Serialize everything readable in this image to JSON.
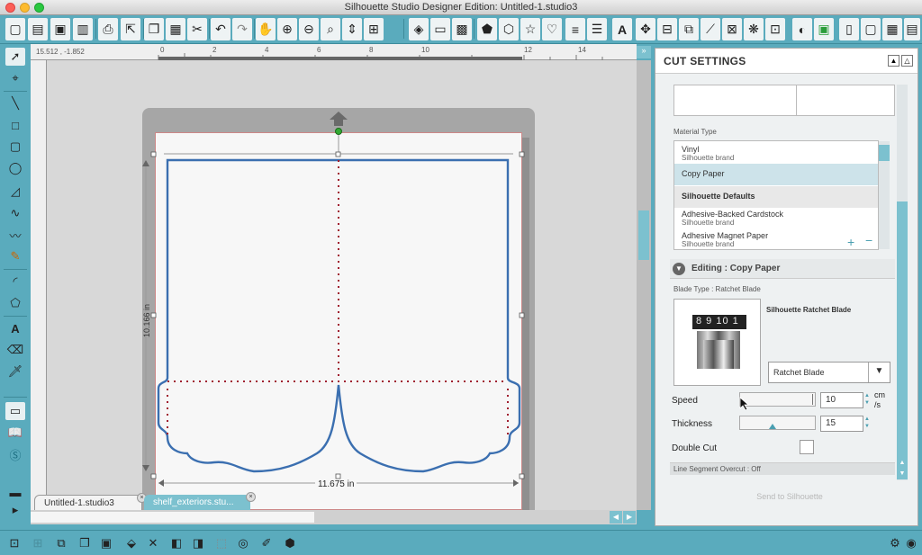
{
  "window": {
    "title": "Silhouette Studio Designer Edition: Untitled-1.studio3"
  },
  "ruler": {
    "coords": "15.512 , -1.852",
    "top_numbers": [
      "0",
      "2",
      "4",
      "6",
      "8",
      "10",
      "12",
      "14"
    ]
  },
  "canvas": {
    "width_label": "11.675 in",
    "height_label": "10.166 in"
  },
  "tabs": [
    {
      "label": "Untitled-1.studio3"
    },
    {
      "label": "shelf_exteriors.stu..."
    }
  ],
  "panel": {
    "title": "CUT SETTINGS",
    "material_type_label": "Material Type",
    "materials": [
      {
        "name": "Vinyl",
        "brand": "Silhouette brand"
      },
      {
        "name": "Copy Paper",
        "brand": ""
      },
      {
        "name": "Silhouette Defaults",
        "brand": ""
      },
      {
        "name": "Adhesive-Backed Cardstock",
        "brand": "Silhouette brand"
      },
      {
        "name": "Adhesive Magnet Paper",
        "brand": "Silhouette brand"
      }
    ],
    "editing_label": "Editing : Copy Paper",
    "blade_type_label": "Blade Type : Ratchet Blade",
    "blade_name": "Silhouette Ratchet Blade",
    "blade_numbers": "8 9 10 1",
    "blade_select": "Ratchet Blade",
    "speed_label": "Speed",
    "speed_value": "10",
    "speed_unit": "cm /s",
    "thickness_label": "Thickness",
    "thickness_value": "15",
    "double_cut_label": "Double Cut",
    "line_segment_label": "Line Segment Overcut : Off",
    "send_label": "Send to Silhouette"
  }
}
